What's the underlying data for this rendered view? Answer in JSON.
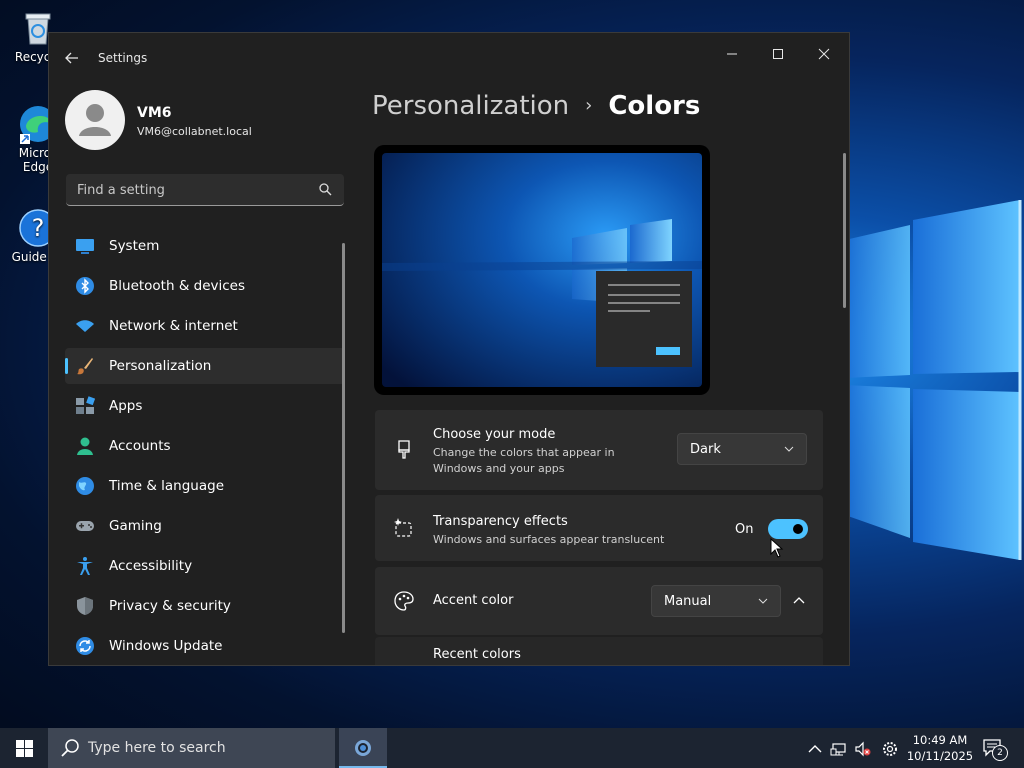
{
  "desktop": {
    "icons": [
      {
        "label": "Recycle",
        "icon": "recycle-bin-icon"
      },
      {
        "label": "Micros Edge",
        "icon": "edge-icon"
      },
      {
        "label": "Guide Fo",
        "icon": "help-icon"
      }
    ]
  },
  "window": {
    "title": "Settings",
    "controls": [
      "minimize-icon",
      "maximize-icon",
      "close-icon"
    ]
  },
  "user": {
    "name": "VM6",
    "email": "VM6@collabnet.local"
  },
  "search": {
    "placeholder": "Find a setting"
  },
  "nav": {
    "items": [
      {
        "label": "System",
        "icon": "system-icon"
      },
      {
        "label": "Bluetooth & devices",
        "icon": "bluetooth-icon"
      },
      {
        "label": "Network & internet",
        "icon": "wifi-icon"
      },
      {
        "label": "Personalization",
        "icon": "brush-icon",
        "active": true
      },
      {
        "label": "Apps",
        "icon": "apps-icon"
      },
      {
        "label": "Accounts",
        "icon": "accounts-icon"
      },
      {
        "label": "Time & language",
        "icon": "globe-icon"
      },
      {
        "label": "Gaming",
        "icon": "gamepad-icon"
      },
      {
        "label": "Accessibility",
        "icon": "accessibility-icon"
      },
      {
        "label": "Privacy & security",
        "icon": "shield-icon"
      },
      {
        "label": "Windows Update",
        "icon": "update-icon"
      }
    ]
  },
  "breadcrumb": {
    "parent": "Personalization",
    "separator": "›",
    "current": "Colors"
  },
  "mode": {
    "title": "Choose your mode",
    "subtitle_line1": "Change the colors that appear in",
    "subtitle_line2": "Windows and your apps",
    "value": "Dark"
  },
  "transparency": {
    "title": "Transparency effects",
    "subtitle": "Windows and surfaces appear translucent",
    "state_label": "On",
    "on": true
  },
  "accent": {
    "title": "Accent color",
    "value": "Manual",
    "recent_label": "Recent colors"
  },
  "colors": {
    "accent": "#4cc2ff",
    "window_bg": "#202020",
    "card_bg": "#2b2b2b"
  },
  "taskbar": {
    "search_placeholder": "Type here to search",
    "time": "10:49 AM",
    "date": "10/11/2025",
    "notification_count": "2"
  }
}
